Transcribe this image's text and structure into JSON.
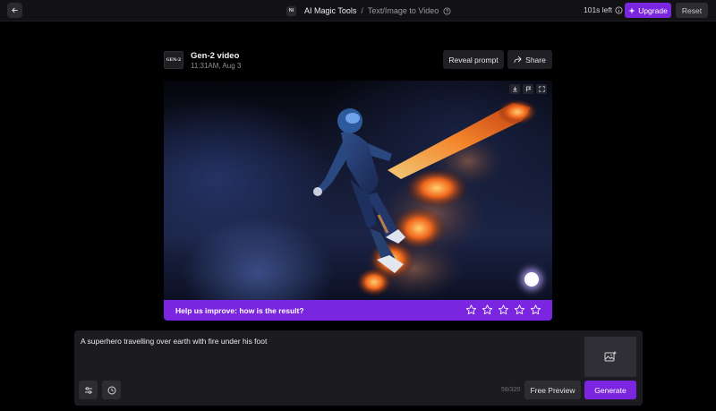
{
  "topbar": {
    "back_icon": "arrow-left-icon",
    "badge": "Ni",
    "tool_name": "AI Magic Tools",
    "separator": "/",
    "page_name": "Text/Image to Video",
    "help_icon": "question-circle-icon",
    "time_left": "101s left",
    "info_icon": "info-circle-icon",
    "upgrade_label": "Upgrade",
    "upgrade_icon": "sparkle-icon",
    "reset_label": "Reset"
  },
  "result": {
    "model_logo": "GEN-2",
    "title": "Gen-2 video",
    "timestamp": "11:31AM, Aug 3",
    "reveal_label": "Reveal prompt",
    "share_label": "Share",
    "share_icon": "share-icon",
    "video_tools": [
      "download-icon",
      "flag-icon",
      "fullscreen-icon"
    ]
  },
  "feedback": {
    "question": "Help us improve: how is the result?",
    "rating_max": 5,
    "rating": 0
  },
  "prompt": {
    "text": "A superhero travelling over earth with fire under his foot",
    "char_count": "58/320",
    "preview_label": "Free Preview",
    "generate_label": "Generate",
    "image_icon": "add-image-icon",
    "settings_icon": "sliders-icon",
    "history_icon": "clock-icon"
  },
  "colors": {
    "accent": "#7a25e0",
    "background": "#000000",
    "panel": "#1c1c20"
  }
}
